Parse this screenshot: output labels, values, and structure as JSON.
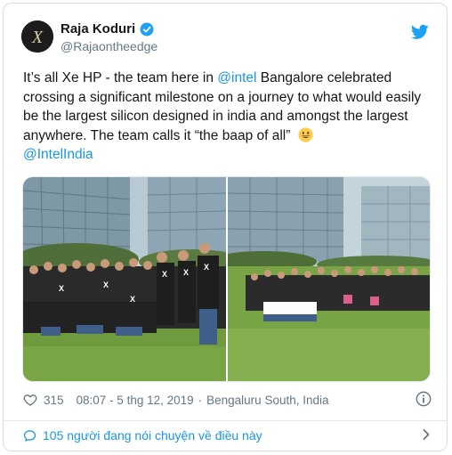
{
  "author": {
    "display_name": "Raja Koduri",
    "handle": "@Rajaontheedge",
    "avatar_letter": "X",
    "verified": true
  },
  "tweet": {
    "text_part1": "It’s all Xe HP - the team here in ",
    "mention1": "@intel",
    "text_part2": " Bangalore celebrated crossing a significant milestone on a journey to what would easily be the largest silicon designed in india and amongst the largest anywhere. The team calls it “the baap of all” ",
    "mention2": "@IntelIndia",
    "emoji": "grinning-face"
  },
  "media": {
    "photo_count": 2,
    "shirt_logo": "X"
  },
  "meta": {
    "likes": "315",
    "time": "08:07 - 5 thg 12, 2019",
    "separator": "·",
    "location": "Bengaluru South, India"
  },
  "conversation": {
    "label": "105 người đang nói chuyện về điều này"
  },
  "colors": {
    "link": "#1b95e0",
    "text": "#14171a",
    "muted": "#657786",
    "border": "#e1e8ed"
  },
  "icons": {
    "bird": "twitter-bird-icon",
    "verified": "verified-badge-icon",
    "like": "heart-icon",
    "info": "info-icon",
    "reply": "speech-bubble-icon",
    "chevron": "chevron-right-icon"
  }
}
